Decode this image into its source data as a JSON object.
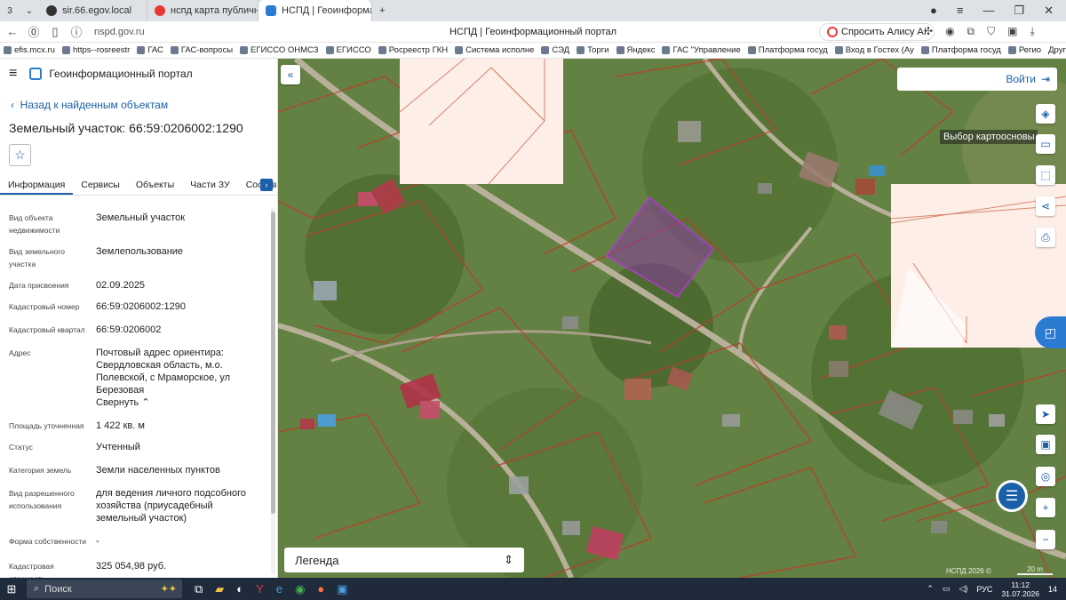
{
  "browser": {
    "tab_count": "3",
    "tabs": [
      {
        "label": "sir.66.egov.local"
      },
      {
        "label": "нспд карта публичная кад"
      },
      {
        "label": "НСПД | Геоинформацио"
      }
    ],
    "new_tab": "+",
    "url": "nspd.gov.ru",
    "page_title": "НСПД | Геоинформационный портал",
    "alice_label": "Спросить Алису AI",
    "bookmarks": [
      "efis.mcx.ru",
      "https--rosreestr",
      "ГАС",
      "ГАС-вопросы",
      "ЕГИССО ОНМСЗ",
      "ЕГИССО",
      "Росреестр ГКН",
      "Система исполне",
      "СЭД",
      "Торги",
      "Яндекс",
      "ГАС \"Управление",
      "Платформа госуд",
      "Вход в Гостех (Ау",
      "Платформа госуд",
      "Регио"
    ],
    "other_bookmarks": "Другие закладки"
  },
  "panel": {
    "app_title": "Геоинформационный портал",
    "back_label": "Назад к найденным объектам",
    "object_title": "Земельный участок: 66:59:0206002:1290",
    "tabs": [
      "Информация",
      "Сервисы",
      "Объекты",
      "Части ЗУ",
      "Состав"
    ],
    "collapse_label": "Свернуть",
    "props": [
      {
        "k": "Вид объекта недвижимости",
        "v": "Земельный участок"
      },
      {
        "k": "Вид земельного участка",
        "v": "Землепользование"
      },
      {
        "k": "Дата присвоения",
        "v": "02.09.2025"
      },
      {
        "k": "Кадастровый номер",
        "v": "66:59:0206002:1290"
      },
      {
        "k": "Кадастровый квартал",
        "v": "66:59:0206002"
      },
      {
        "k": "Адрес",
        "v": "Почтовый адрес ориентира: Свердловская область, м.о. Полевской, с Мраморское, ул Березовая"
      },
      {
        "k": "Площадь уточненная",
        "v": "1 422 кв. м"
      },
      {
        "k": "Статус",
        "v": "Учтенный"
      },
      {
        "k": "Категория земель",
        "v": "Земли населенных пунктов"
      },
      {
        "k": "Вид разрешенного использования",
        "v": "для ведения личного подсобного хозяйства (приусадебный земельный участок)"
      },
      {
        "k": "Форма собственности",
        "v": "-"
      },
      {
        "k": "Кадастровая стоимость",
        "v": "325 054,98 руб."
      }
    ]
  },
  "map": {
    "login_label": "Войти",
    "basemap_tooltip": "Выбор картоосновы",
    "legend_label": "Легенда",
    "copyright": "НСПД 2026 ©",
    "scale_label": "20 m"
  },
  "taskbar": {
    "search_label": "Поиск",
    "lang": "РУС",
    "time": "11:12",
    "date": "31.07.2026",
    "notifications": "14"
  }
}
